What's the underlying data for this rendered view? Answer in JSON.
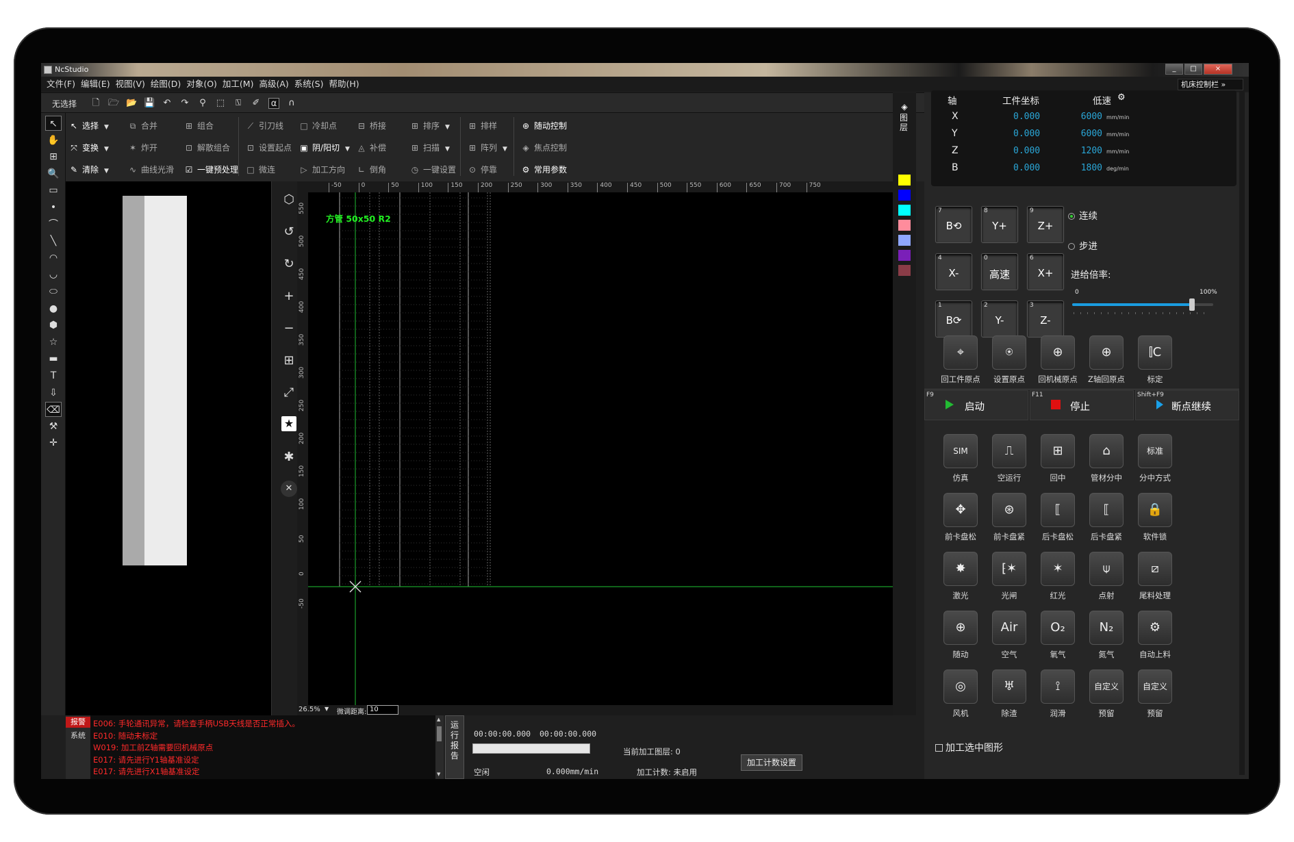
{
  "window": {
    "title": "NcStudio",
    "controls": [
      "_",
      "□",
      "×"
    ]
  },
  "menu": [
    "文件(F)",
    "编辑(E)",
    "视图(V)",
    "绘图(D)",
    "对象(O)",
    "加工(M)",
    "高级(A)",
    "系统(S)",
    "帮助(H)"
  ],
  "machine_bar": "机床控制栏 »",
  "toolbar": {
    "selection_label": "无选择",
    "icons": [
      "new-file-icon",
      "open-folder-icon",
      "open-icon",
      "save-icon",
      "undo-icon",
      "redo-icon",
      "funnel-icon",
      "select-rect-icon",
      "measure-icon",
      "pen-icon",
      "alpha-icon",
      "omega-icon"
    ]
  },
  "ribbon": {
    "col1": [
      {
        "icon": "↖",
        "label": "选择",
        "on": true,
        "dd": true
      },
      {
        "icon": "⤧",
        "label": "变换",
        "on": true,
        "dd": true
      },
      {
        "icon": "✎",
        "label": "清除",
        "on": true,
        "dd": true
      }
    ],
    "col2": [
      {
        "icon": "⧉",
        "label": "合并"
      },
      {
        "icon": "✶",
        "label": "炸开"
      },
      {
        "icon": "∿",
        "label": "曲线光滑"
      }
    ],
    "col3": [
      {
        "icon": "⊞",
        "label": "组合"
      },
      {
        "icon": "⊡",
        "label": "解散组合"
      },
      {
        "icon": "☑",
        "label": "一键预处理",
        "on": true
      }
    ],
    "col4": [
      {
        "icon": "⟋",
        "label": "引刀线"
      },
      {
        "icon": "⊡",
        "label": "设置起点"
      },
      {
        "icon": "□",
        "label": "微连"
      }
    ],
    "col5": [
      {
        "icon": "□",
        "label": "冷却点"
      },
      {
        "icon": "▣",
        "label": "阴/阳切",
        "on": true,
        "dd": true
      },
      {
        "icon": "▷",
        "label": "加工方向"
      }
    ],
    "col6": [
      {
        "icon": "⊟",
        "label": "桥接"
      },
      {
        "icon": "◬",
        "label": "补偿"
      },
      {
        "icon": "∟",
        "label": "倒角"
      }
    ],
    "col7": [
      {
        "icon": "⊞",
        "label": "排序",
        "dd": true
      },
      {
        "icon": "⊞",
        "label": "扫描",
        "dd": true
      },
      {
        "icon": "◷",
        "label": "一键设置"
      }
    ],
    "col8": [
      {
        "icon": "⊞",
        "label": "排样"
      },
      {
        "icon": "⊞",
        "label": "阵列",
        "dd": true
      },
      {
        "icon": "⊙",
        "label": "停靠"
      }
    ],
    "col9": [
      {
        "icon": "⊕",
        "label": "随动控制",
        "on": true
      },
      {
        "icon": "◈",
        "label": "焦点控制"
      },
      {
        "icon": "⚙",
        "label": "常用参数",
        "on": true
      }
    ]
  },
  "left_tools": [
    "pointer-icon",
    "hand-icon",
    "zoom-fit-icon",
    "zoom-icon",
    "ruler-icon",
    "point-icon",
    "polyline-icon",
    "line-icon",
    "arc-icon",
    "arc2-icon",
    "ellipse-icon",
    "circle-icon",
    "polygon-icon",
    "star-icon",
    "rectangle-icon",
    "text-icon",
    "import-icon",
    "eraser-icon",
    "hammer-icon",
    "crosshair-icon"
  ],
  "canvas_tools": [
    "cube-icon",
    "rotate-ccw-icon",
    "rotate-cw-icon",
    "plus-icon",
    "minus-icon",
    "fit-icon",
    "fullscreen-icon",
    "star-box-icon",
    "asterisk-icon",
    "close-circle-icon"
  ],
  "layers_label": "图层",
  "layer_colors": [
    "#ffff00",
    "#0000ff",
    "#00ffff",
    "#ff8c9c",
    "#8fa7ff",
    "#7a1fb8",
    "#8a3c47"
  ],
  "drawing": {
    "part_label": "方管 50x50 R2",
    "ruler_top": [
      "-50",
      "0",
      "50",
      "100",
      "150",
      "200",
      "250",
      "300",
      "350",
      "400",
      "450",
      "500",
      "550",
      "600",
      "650",
      "700",
      "750"
    ],
    "ruler_left": [
      "550",
      "500",
      "450",
      "400",
      "350",
      "300",
      "250",
      "200",
      "150",
      "100",
      "50",
      "0",
      "-50"
    ]
  },
  "status": {
    "zoom": "26.5%",
    "fine_label": "微调距离:",
    "fine_value": "10"
  },
  "axis": {
    "headers": [
      "轴",
      "工件坐标",
      "低速"
    ],
    "rows": [
      {
        "axis": "X",
        "coord": "0.000",
        "speed": "6000",
        "unit": "mm/min"
      },
      {
        "axis": "Y",
        "coord": "0.000",
        "speed": "6000",
        "unit": "mm/min"
      },
      {
        "axis": "Z",
        "coord": "0.000",
        "speed": "1200",
        "unit": "mm/min"
      },
      {
        "axis": "B",
        "coord": "0.000",
        "speed": "1800",
        "unit": "deg/min"
      }
    ]
  },
  "jog": [
    {
      "n": "7",
      "t": "B⟲"
    },
    {
      "n": "8",
      "t": "Y+"
    },
    {
      "n": "9",
      "t": "Z+"
    },
    {
      "n": "4",
      "t": "X-"
    },
    {
      "n": "0",
      "t": "高速"
    },
    {
      "n": "6",
      "t": "X+"
    },
    {
      "n": "1",
      "t": "B⟳"
    },
    {
      "n": "2",
      "t": "Y-"
    },
    {
      "n": "3",
      "t": "Z-"
    }
  ],
  "mode": {
    "continuous": "连续",
    "step": "步进",
    "feed_label": "进给倍率:",
    "slider_min": "0",
    "slider_max": "100%",
    "slider_value": 0.85
  },
  "origin_buttons": [
    {
      "icon": "⌖",
      "label": "回工件原点"
    },
    {
      "icon": "⍟",
      "label": "设置原点"
    },
    {
      "icon": "⊕",
      "label": "回机械原点"
    },
    {
      "icon": "⊕",
      "label": "Z轴回原点"
    },
    {
      "icon": "⫿C",
      "label": "标定"
    }
  ],
  "run": [
    {
      "key": "F9",
      "label": "启动",
      "color": "#22bb33"
    },
    {
      "key": "F11",
      "label": "停止",
      "color": "#e01010"
    },
    {
      "key": "Shift+F9",
      "label": "断点继续",
      "color": "#1aa0e8"
    }
  ],
  "grid_buttons": [
    {
      "icon": "SIM",
      "label": "仿真",
      "small": true
    },
    {
      "icon": "⎍",
      "label": "空运行"
    },
    {
      "icon": "⊞",
      "label": "回中"
    },
    {
      "icon": "⌂",
      "label": "管材分中"
    },
    {
      "icon": "标准",
      "label": "分中方式",
      "small": true
    },
    {
      "icon": "✥",
      "label": "前卡盘松"
    },
    {
      "icon": "⊛",
      "label": "前卡盘紧"
    },
    {
      "icon": "⟦",
      "label": "后卡盘松"
    },
    {
      "icon": "⟦",
      "label": "后卡盘紧"
    },
    {
      "icon": "🔒",
      "label": "软件锁"
    },
    {
      "icon": "✸",
      "label": "激光"
    },
    {
      "icon": "⁅✶",
      "label": "光闸"
    },
    {
      "icon": "✶",
      "label": "红光"
    },
    {
      "icon": "⍦",
      "label": "点射"
    },
    {
      "icon": "⧄",
      "label": "尾料处理"
    },
    {
      "icon": "⊕",
      "label": "随动"
    },
    {
      "icon": "Air",
      "label": "空气"
    },
    {
      "icon": "O₂",
      "label": "氧气"
    },
    {
      "icon": "N₂",
      "label": "氮气"
    },
    {
      "icon": "⚙",
      "label": "自动上料"
    },
    {
      "icon": "◎",
      "label": "风机"
    },
    {
      "icon": "♅",
      "label": "除渣"
    },
    {
      "icon": "⟟",
      "label": "润滑"
    },
    {
      "icon": "自定义",
      "label": "预留",
      "small": true
    },
    {
      "icon": "自定义",
      "label": "预留",
      "small": true
    }
  ],
  "process_selected": "加工选中图形",
  "log": {
    "tabs": [
      "报警",
      "系统"
    ],
    "lines": [
      "E006: 手轮通讯异常，请检查手柄USB天线是否正常插入。",
      "E010: 随动未标定",
      "W019: 加工前Z轴需要回机械原点",
      "E017: 请先进行Y1轴基准设定",
      "E017: 请先进行X1轴基准设定"
    ]
  },
  "report_tab": [
    "运",
    "行",
    "报",
    "告"
  ],
  "runinfo": {
    "time1": "00:00:00.000",
    "time2": "00:00:00.000",
    "layer_label": "当前加工图层: 0",
    "state": "空闲",
    "speed": "0.000mm/min",
    "count_label": "加工计数: 未启用",
    "count_button": "加工计数设置"
  }
}
